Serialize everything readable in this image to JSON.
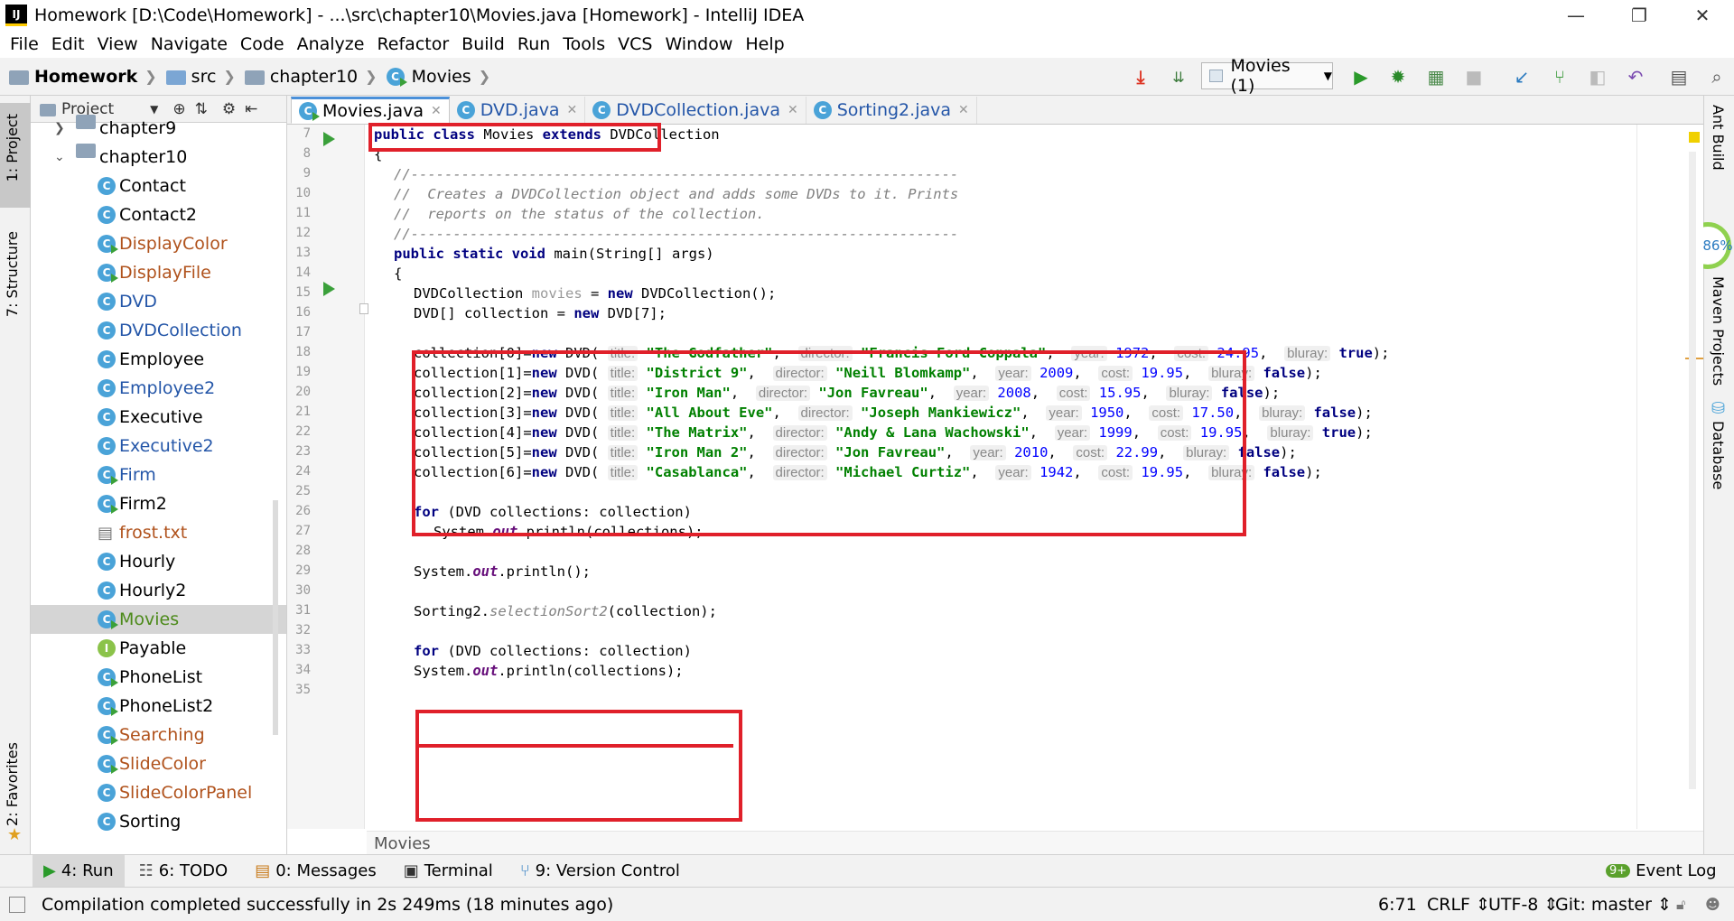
{
  "window": {
    "title": "Homework [D:\\Code\\Homework] - ...\\src\\chapter10\\Movies.java [Homework] - IntelliJ IDEA"
  },
  "menu": [
    "File",
    "Edit",
    "View",
    "Navigate",
    "Code",
    "Analyze",
    "Refactor",
    "Build",
    "Run",
    "Tools",
    "VCS",
    "Window",
    "Help"
  ],
  "breadcrumb": [
    "Homework",
    "src",
    "chapter10",
    "Movies"
  ],
  "run_config": "Movies (1)",
  "project_panel": {
    "title": "Project",
    "tree": [
      {
        "label": "chapter9",
        "kind": "folder",
        "color": "#000000"
      },
      {
        "label": "chapter10",
        "kind": "folder",
        "color": "#000000"
      },
      {
        "label": "Contact",
        "kind": "class",
        "color": "#000000"
      },
      {
        "label": "Contact2",
        "kind": "class",
        "color": "#000000"
      },
      {
        "label": "DisplayColor",
        "kind": "runclass",
        "color": "#b0521c"
      },
      {
        "label": "DisplayFile",
        "kind": "runclass",
        "color": "#b0521c"
      },
      {
        "label": "DVD",
        "kind": "class",
        "color": "#2456a8"
      },
      {
        "label": "DVDCollection",
        "kind": "class",
        "color": "#2456a8"
      },
      {
        "label": "Employee",
        "kind": "class",
        "color": "#000000"
      },
      {
        "label": "Employee2",
        "kind": "class",
        "color": "#2456a8"
      },
      {
        "label": "Executive",
        "kind": "class",
        "color": "#000000"
      },
      {
        "label": "Executive2",
        "kind": "class",
        "color": "#2456a8"
      },
      {
        "label": "Firm",
        "kind": "runclass",
        "color": "#2456a8"
      },
      {
        "label": "Firm2",
        "kind": "runclass",
        "color": "#000000"
      },
      {
        "label": "frost.txt",
        "kind": "file",
        "color": "#b0521c"
      },
      {
        "label": "Hourly",
        "kind": "class",
        "color": "#000000"
      },
      {
        "label": "Hourly2",
        "kind": "class",
        "color": "#000000"
      },
      {
        "label": "Movies",
        "kind": "runclass",
        "color": "#4c8a1a"
      },
      {
        "label": "Payable",
        "kind": "iface",
        "color": "#000000"
      },
      {
        "label": "PhoneList",
        "kind": "runclass",
        "color": "#000000"
      },
      {
        "label": "PhoneList2",
        "kind": "runclass",
        "color": "#000000"
      },
      {
        "label": "Searching",
        "kind": "runclass",
        "color": "#b0521c"
      },
      {
        "label": "SlideColor",
        "kind": "runclass",
        "color": "#b0521c"
      },
      {
        "label": "SlideColorPanel",
        "kind": "class",
        "color": "#b0521c"
      },
      {
        "label": "Sorting",
        "kind": "class",
        "color": "#000000"
      }
    ]
  },
  "tabs": [
    "Movies.java",
    "DVD.java",
    "DVDCollection.java",
    "Sorting2.java"
  ],
  "left_tools": [
    "1: Project",
    "7: Structure",
    "2: Favorites"
  ],
  "right_tools": [
    "Ant Build",
    "Maven Projects",
    "Database"
  ],
  "cpu_badge": "86%",
  "editor_breadcrumb": "Movies",
  "line_numbers": [
    "7",
    "8",
    "9",
    "10",
    "11",
    "12",
    "13",
    "14",
    "15",
    "16",
    "17",
    "18",
    "19",
    "20",
    "21",
    "22",
    "23",
    "24",
    "25",
    "26",
    "27",
    "28",
    "29",
    "30",
    "31",
    "32",
    "33",
    "34",
    "35"
  ],
  "code": {
    "l7": [
      "public class ",
      "Movies ",
      "extends ",
      "DVDCollection"
    ],
    "l8": "{",
    "l9": "//-----------------------------------------------------------------",
    "l10": "//  Creates a DVDCollection object and adds some DVDs to it. Prints",
    "l11": "//  reports on the status of the collection.",
    "l12": "//-----------------------------------------------------------------",
    "l13": [
      "public static void ",
      "main(String[] args)"
    ],
    "l14": "{",
    "l15": [
      "DVDCollection ",
      "movies",
      " = ",
      "new ",
      "DVDCollection();"
    ],
    "l16": [
      "DVD[] collection = ",
      "new ",
      "DVD[7];"
    ],
    "hints": [
      "title:",
      "director:",
      "year:",
      "cost:",
      "bluray:"
    ],
    "dvds": [
      {
        "idx": "0",
        "title": "\"The Godfather\"",
        "director": "\"Francis Ford Coppala\"",
        "year": "1972",
        "cost": "24.95",
        "bluray": "true"
      },
      {
        "idx": "1",
        "title": "\"District 9\"",
        "director": "\"Neill Blomkamp\"",
        "year": "2009",
        "cost": "19.95",
        "bluray": "false"
      },
      {
        "idx": "2",
        "title": "\"Iron Man\"",
        "director": "\"Jon Favreau\"",
        "year": "2008",
        "cost": "15.95",
        "bluray": "false"
      },
      {
        "idx": "3",
        "title": "\"All About Eve\"",
        "director": "\"Joseph Mankiewicz\"",
        "year": "1950",
        "cost": "17.50",
        "bluray": "false"
      },
      {
        "idx": "4",
        "title": "\"The Matrix\"",
        "director": "\"Andy & Lana Wachowski\"",
        "year": "1999",
        "cost": "19.95",
        "bluray": "true"
      },
      {
        "idx": "5",
        "title": "\"Iron Man 2\"",
        "director": "\"Jon Favreau\"",
        "year": "2010",
        "cost": "22.99",
        "bluray": "false"
      },
      {
        "idx": "6",
        "title": "\"Casablanca\"",
        "director": "\"Michael Curtiz\"",
        "year": "1942",
        "cost": "19.95",
        "bluray": "false"
      }
    ],
    "l26": [
      "for ",
      "(DVD collections: collection)"
    ],
    "l27": [
      "System.",
      "out",
      ".println(collections);"
    ],
    "l29": [
      "System.",
      "out",
      ".println();"
    ],
    "l31": [
      "Sorting2.",
      "selectionSort2",
      "(collection);"
    ],
    "l33": [
      "for ",
      "(DVD collections: collection)"
    ],
    "l34": [
      "System.",
      "out",
      ".println(collections);"
    ]
  },
  "bottom_tools": [
    "4: Run",
    "6: TODO",
    "0: Messages",
    "Terminal",
    "9: Version Control",
    "Event Log"
  ],
  "event_badge": "9+",
  "status": {
    "message": "Compilation completed successfully in 2s 249ms (18 minutes ago)",
    "position": "6:71",
    "line_sep": "CRLF",
    "encoding": "UTF-8",
    "vcs": "Git: master"
  }
}
